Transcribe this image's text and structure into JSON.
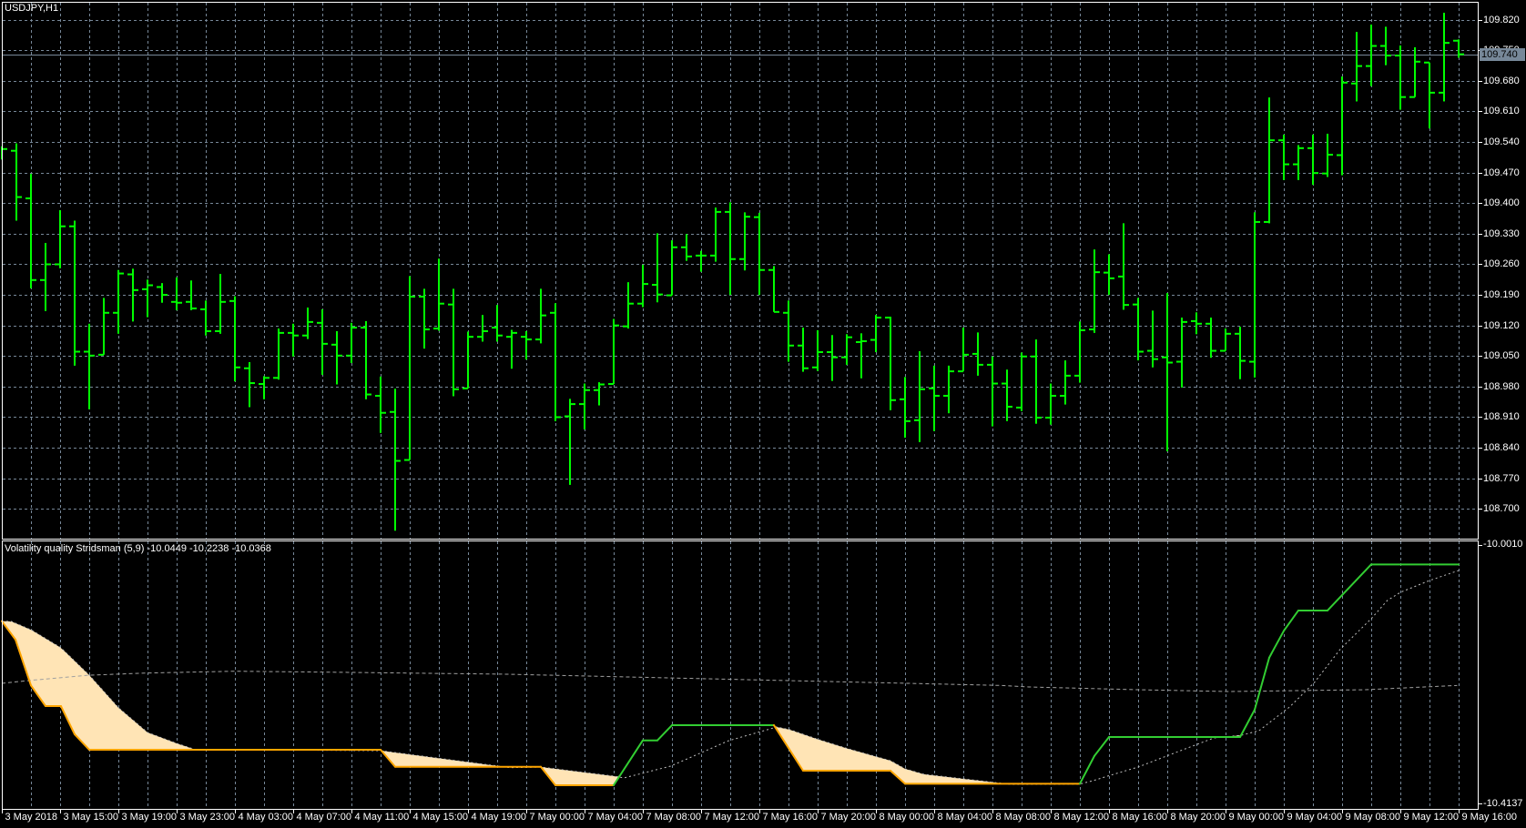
{
  "window": {
    "symbol_title": "USDJPY,H1"
  },
  "colors": {
    "bar": "#00ff00",
    "grid": "#778899",
    "frame": "#ffffff",
    "main_up": "#32cd32",
    "main_down": "#ffa500",
    "fill": "#ffe4b5",
    "dotted": "#c0c0c0",
    "bid_line": "#778899"
  },
  "price_axis": {
    "labels": [
      "109.820",
      "109.750",
      "109.680",
      "109.610",
      "109.540",
      "109.470",
      "109.400",
      "109.330",
      "109.260",
      "109.190",
      "109.120",
      "109.050",
      "108.980",
      "108.910",
      "108.840",
      "108.770",
      "108.700"
    ],
    "bid_label": "109.740",
    "bid": 109.74
  },
  "time_axis": {
    "labels": [
      "3 May 2018",
      "3 May 15:00",
      "3 May 19:00",
      "3 May 23:00",
      "4 May 03:00",
      "4 May 07:00",
      "4 May 11:00",
      "4 May 15:00",
      "4 May 19:00",
      "7 May 00:00",
      "7 May 04:00",
      "7 May 08:00",
      "7 May 12:00",
      "7 May 16:00",
      "7 May 20:00",
      "8 May 00:00",
      "8 May 04:00",
      "8 May 08:00",
      "8 May 12:00",
      "8 May 16:00",
      "8 May 20:00",
      "9 May 00:00",
      "9 May 04:00",
      "9 May 08:00",
      "9 May 12:00",
      "9 May 16:00"
    ]
  },
  "indicator": {
    "title": "Volatility quality Stridsman (5,9) -10.0449 -10.2238 -10.0368",
    "scale_top": "-10.0010",
    "scale_bottom": "-10.4137"
  },
  "chart_data": [
    {
      "type": "ohlc",
      "title": "USDJPY,H1",
      "ylim": [
        108.7,
        109.82
      ],
      "x_count": 101,
      "ohlc": [
        [
          109.52,
          109.53,
          109.5,
          109.524
        ],
        [
          109.52,
          109.537,
          109.36,
          109.414
        ],
        [
          109.411,
          109.467,
          109.205,
          109.224
        ],
        [
          109.224,
          109.309,
          109.153,
          109.26
        ],
        [
          109.26,
          109.384,
          109.251,
          109.347
        ],
        [
          109.347,
          109.36,
          109.028,
          109.06
        ],
        [
          109.06,
          109.124,
          108.928,
          109.051
        ],
        [
          109.053,
          109.183,
          109.053,
          109.149
        ],
        [
          109.149,
          109.247,
          109.101,
          109.239
        ],
        [
          109.237,
          109.25,
          109.129,
          109.201
        ],
        [
          109.203,
          109.225,
          109.139,
          109.212
        ],
        [
          109.208,
          109.217,
          109.172,
          109.19
        ],
        [
          109.174,
          109.23,
          109.155,
          109.172
        ],
        [
          109.174,
          109.223,
          109.155,
          109.159
        ],
        [
          109.157,
          109.177,
          109.097,
          109.107
        ],
        [
          109.107,
          109.238,
          109.101,
          109.174
        ],
        [
          109.176,
          109.187,
          108.992,
          109.024
        ],
        [
          109.022,
          109.036,
          108.933,
          108.988
        ],
        [
          108.986,
          109.004,
          108.951,
          109.0
        ],
        [
          109.0,
          109.113,
          108.996,
          109.103
        ],
        [
          109.103,
          109.124,
          109.049,
          109.097
        ],
        [
          109.097,
          109.161,
          109.089,
          109.128
        ],
        [
          109.126,
          109.157,
          109.007,
          109.078
        ],
        [
          109.076,
          109.107,
          108.985,
          109.051
        ],
        [
          109.051,
          109.126,
          109.034,
          109.115
        ],
        [
          109.115,
          109.13,
          108.951,
          108.962
        ],
        [
          108.959,
          109.003,
          108.874,
          108.92
        ],
        [
          108.922,
          108.975,
          108.65,
          108.81
        ],
        [
          108.812,
          109.233,
          108.812,
          109.186
        ],
        [
          109.186,
          109.204,
          109.067,
          109.111
        ],
        [
          109.113,
          109.273,
          109.108,
          109.17
        ],
        [
          109.168,
          109.204,
          108.958,
          108.974
        ],
        [
          108.976,
          109.106,
          108.976,
          109.094
        ],
        [
          109.094,
          109.144,
          109.083,
          109.107
        ],
        [
          109.115,
          109.167,
          109.083,
          109.097
        ],
        [
          109.094,
          109.11,
          109.021,
          109.103
        ],
        [
          109.094,
          109.107,
          109.042,
          109.088
        ],
        [
          109.088,
          109.204,
          109.079,
          109.143
        ],
        [
          109.149,
          109.171,
          108.901,
          108.91
        ],
        [
          108.912,
          108.952,
          108.755,
          108.94
        ],
        [
          108.94,
          108.987,
          108.882,
          108.972
        ],
        [
          108.972,
          108.99,
          108.937,
          108.985
        ],
        [
          108.986,
          109.135,
          108.986,
          109.12
        ],
        [
          109.118,
          109.219,
          109.113,
          109.17
        ],
        [
          109.17,
          109.259,
          109.162,
          109.215
        ],
        [
          109.213,
          109.331,
          109.173,
          109.191
        ],
        [
          109.189,
          109.315,
          109.189,
          109.299
        ],
        [
          109.299,
          109.329,
          109.268,
          109.278
        ],
        [
          109.28,
          109.291,
          109.243,
          109.28
        ],
        [
          109.28,
          109.39,
          109.266,
          109.38
        ],
        [
          109.38,
          109.402,
          109.19,
          109.272
        ],
        [
          109.272,
          109.379,
          109.246,
          109.369
        ],
        [
          109.368,
          109.378,
          109.19,
          109.247
        ],
        [
          109.247,
          109.256,
          109.151,
          109.151
        ],
        [
          109.149,
          109.177,
          109.037,
          109.074
        ],
        [
          109.074,
          109.115,
          109.014,
          109.022
        ],
        [
          109.024,
          109.109,
          109.016,
          109.059
        ],
        [
          109.059,
          109.098,
          108.993,
          109.047
        ],
        [
          109.047,
          109.1,
          109.03,
          109.093
        ],
        [
          109.082,
          109.102,
          108.999,
          109.084
        ],
        [
          109.087,
          109.144,
          109.059,
          109.138
        ],
        [
          109.138,
          109.14,
          108.926,
          108.949
        ],
        [
          108.951,
          109.002,
          108.863,
          108.901
        ],
        [
          108.903,
          109.061,
          108.853,
          108.974
        ],
        [
          108.976,
          109.028,
          108.878,
          108.959
        ],
        [
          108.959,
          109.028,
          108.919,
          109.015
        ],
        [
          109.015,
          109.115,
          109.015,
          109.053
        ],
        [
          109.055,
          109.104,
          109.005,
          109.03
        ],
        [
          109.03,
          109.049,
          108.889,
          108.987
        ],
        [
          108.987,
          109.019,
          108.901,
          108.934
        ],
        [
          108.932,
          109.058,
          108.924,
          109.049
        ],
        [
          109.049,
          109.088,
          108.895,
          108.909
        ],
        [
          108.909,
          108.987,
          108.893,
          108.959
        ],
        [
          108.959,
          109.04,
          108.939,
          109.005
        ],
        [
          109.005,
          109.129,
          108.989,
          109.109
        ],
        [
          109.111,
          109.294,
          109.103,
          109.242
        ],
        [
          109.241,
          109.283,
          109.19,
          109.228
        ],
        [
          109.232,
          109.354,
          109.156,
          109.167
        ],
        [
          109.168,
          109.183,
          109.04,
          109.06
        ],
        [
          109.062,
          109.154,
          109.024,
          109.043
        ],
        [
          109.047,
          109.194,
          108.832,
          109.035
        ],
        [
          109.037,
          109.138,
          108.978,
          109.128
        ],
        [
          109.13,
          109.15,
          109.1,
          109.124
        ],
        [
          109.124,
          109.138,
          109.046,
          109.062
        ],
        [
          109.062,
          109.113,
          109.062,
          109.101
        ],
        [
          109.101,
          109.117,
          108.997,
          109.039
        ],
        [
          109.037,
          109.379,
          109.001,
          109.357
        ],
        [
          109.357,
          109.642,
          109.354,
          109.544
        ],
        [
          109.544,
          109.557,
          109.453,
          109.489
        ],
        [
          109.489,
          109.533,
          109.453,
          109.526
        ],
        [
          109.526,
          109.557,
          109.442,
          109.469
        ],
        [
          109.468,
          109.559,
          109.46,
          109.511
        ],
        [
          109.51,
          109.69,
          109.464,
          109.676
        ],
        [
          109.674,
          109.792,
          109.633,
          109.714
        ],
        [
          109.714,
          109.809,
          109.668,
          109.76
        ],
        [
          109.76,
          109.804,
          109.716,
          109.738
        ],
        [
          109.738,
          109.761,
          109.614,
          109.643
        ],
        [
          109.643,
          109.757,
          109.643,
          109.724
        ],
        [
          109.722,
          109.722,
          109.571,
          109.653
        ],
        [
          109.653,
          109.836,
          109.633,
          109.767
        ],
        [
          109.772,
          109.775,
          109.733,
          109.741
        ]
      ]
    },
    {
      "type": "line",
      "title": "Volatility quality Stridsman (5,9)",
      "ylim": [
        -10.4137,
        -10.001
      ],
      "series": [
        {
          "name": "main",
          "points": [
            [
              0,
              -10.122
            ],
            [
              0.94,
              -10.1515
            ],
            [
              2,
              -10.2245
            ],
            [
              3,
              -10.2574
            ],
            [
              4.06,
              -10.2574
            ],
            [
              5,
              -10.3024
            ],
            [
              6,
              -10.327
            ],
            [
              26,
              -10.327
            ],
            [
              27,
              -10.3542
            ],
            [
              37,
              -10.3542
            ],
            [
              38,
              -10.3836
            ],
            [
              42,
              -10.3836
            ],
            [
              44,
              -10.3121
            ],
            [
              45,
              -10.3121
            ],
            [
              46,
              -10.2879
            ],
            [
              53,
              -10.2879
            ],
            [
              55,
              -10.3604
            ],
            [
              61,
              -10.3604
            ],
            [
              62,
              -10.3812
            ],
            [
              74,
              -10.3812
            ],
            [
              75,
              -10.3368
            ],
            [
              76,
              -10.3067
            ],
            [
              85,
              -10.3067
            ],
            [
              86,
              -10.2632
            ],
            [
              87,
              -10.1801
            ],
            [
              88,
              -10.1374
            ],
            [
              89,
              -10.105
            ],
            [
              91,
              -10.105
            ],
            [
              94,
              -10.0315
            ],
            [
              100,
              -10.0315
            ]
          ]
        },
        {
          "name": "signal",
          "points": [
            [
              0,
              -10.122
            ],
            [
              0.66,
              -10.1224
            ],
            [
              2.06,
              -10.1365
            ],
            [
              4.06,
              -10.1645
            ],
            [
              6,
              -10.2081
            ],
            [
              8,
              -10.2599
            ],
            [
              10,
              -10.2995
            ],
            [
              12,
              -10.3169
            ],
            [
              13.25,
              -10.3266
            ],
            [
              26,
              -10.3285
            ],
            [
              34.9,
              -10.3556
            ],
            [
              37,
              -10.3546
            ],
            [
              42,
              -10.3691
            ],
            [
              42.7,
              -10.372
            ],
            [
              45.9,
              -10.3532
            ],
            [
              49.9,
              -10.3125
            ],
            [
              53.2,
              -10.2908
            ],
            [
              54.1,
              -10.2951
            ],
            [
              55.9,
              -10.3096
            ],
            [
              58.1,
              -10.3256
            ],
            [
              61,
              -10.3445
            ],
            [
              62,
              -10.3575
            ],
            [
              63.3,
              -10.3662
            ],
            [
              69.25,
              -10.3822
            ],
            [
              74,
              -10.3818
            ],
            [
              74.9,
              -10.3764
            ],
            [
              76.1,
              -10.3677
            ],
            [
              78,
              -10.3546
            ],
            [
              80.1,
              -10.3357
            ],
            [
              83.2,
              -10.3082
            ],
            [
              85.1,
              -10.3039
            ],
            [
              86.3,
              -10.2966
            ],
            [
              88.4,
              -10.2588
            ],
            [
              90.1,
              -10.2197
            ],
            [
              91.9,
              -10.166
            ],
            [
              94,
              -10.1181
            ],
            [
              95.1,
              -10.0891
            ],
            [
              96,
              -10.076
            ],
            [
              98,
              -10.0572
            ],
            [
              100,
              -10.0412
            ]
          ]
        },
        {
          "name": "level",
          "points": [
            [
              0,
              -10.2211
            ],
            [
              2,
              -10.2163
            ],
            [
              6,
              -10.2081
            ],
            [
              10,
              -10.2047
            ],
            [
              16,
              -10.2018
            ],
            [
              24,
              -10.2037
            ],
            [
              34.7,
              -10.2066
            ],
            [
              68.6,
              -10.2245
            ],
            [
              70.5,
              -10.2269
            ],
            [
              78,
              -10.2313
            ],
            [
              84.2,
              -10.2342
            ],
            [
              93.6,
              -10.2313
            ],
            [
              99.9,
              -10.2245
            ]
          ]
        }
      ]
    }
  ]
}
